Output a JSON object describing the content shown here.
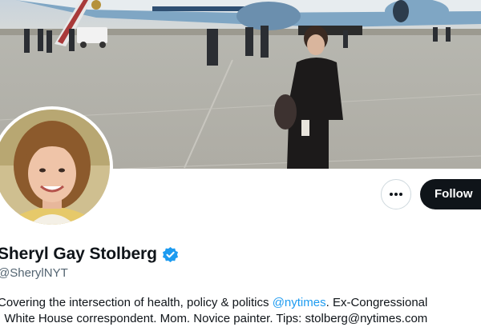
{
  "profile": {
    "display_name": "Sheryl Gay Stolberg",
    "handle": "@SherylNYT",
    "verified": true,
    "bio": {
      "line1_prefix": "Covering the intersection of health, policy & politics ",
      "line1_mention": "@nytimes",
      "line1_suffix": ". Ex-Congressional",
      "line2": ", White House correspondent. Mom. Novice painter. Tips: stolberg@nytimes.com"
    }
  },
  "actions": {
    "more_icon": "ellipsis-icon",
    "follow_label": "Follow"
  },
  "banner": {
    "description_icon": "banner-photo"
  },
  "colors": {
    "accent": "#1d9bf0",
    "text_primary": "#0f1419",
    "text_secondary": "#536471",
    "follow_bg": "#0f1419",
    "border": "#cfd9de"
  }
}
